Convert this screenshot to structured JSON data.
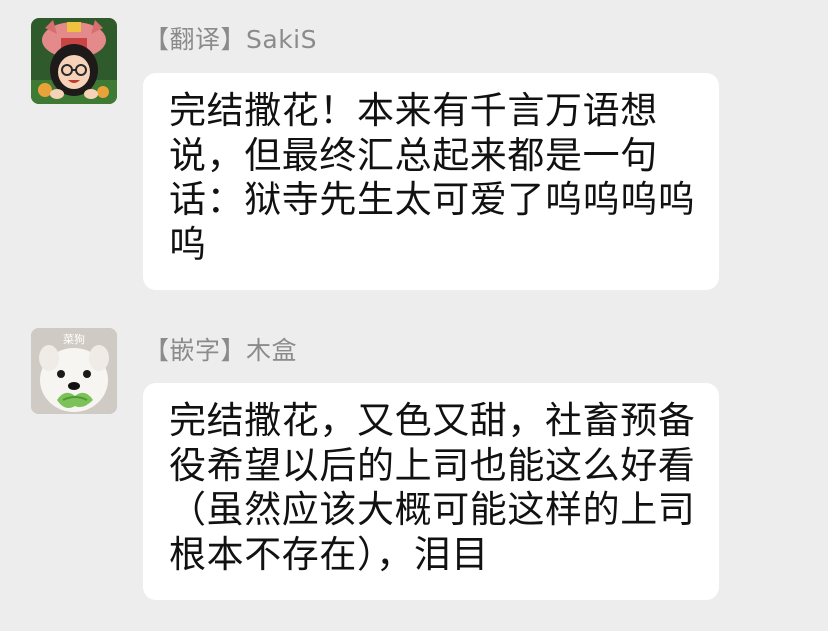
{
  "messages": [
    {
      "sender": "【翻译】SakiS",
      "text": "完结撒花！本来有千言万语想说，但最终汇总起来都是一句话：狱寺先生太可爱了呜呜呜呜呜"
    },
    {
      "sender": "【嵌字】木盒",
      "avatar_badge": "菜狗",
      "text": "完结撒花，又色又甜，社畜预备役希望以后的上司也能这么好看（虽然应该大概可能这样的上司根本不存在），泪目"
    }
  ],
  "colors": {
    "background": "#ededed",
    "bubble": "#ffffff",
    "sender_name": "#8b8b8b",
    "message_text": "#111111"
  }
}
